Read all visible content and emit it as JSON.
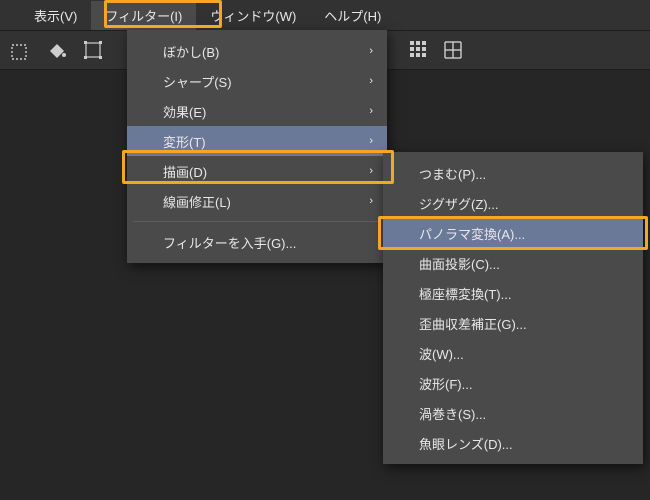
{
  "menubar": {
    "view": "表示(V)",
    "filter": "フィルター(I)",
    "window": "ウィンドウ(W)",
    "help": "ヘルプ(H)"
  },
  "filter_menu": {
    "blur": "ぼかし(B)",
    "sharpen": "シャープ(S)",
    "effect": "効果(E)",
    "transform": "変形(T)",
    "render": "描画(D)",
    "lineart": "線画修正(L)",
    "get": "フィルターを入手(G)..."
  },
  "transform_submenu": {
    "pinch": "つまむ(P)...",
    "zigzag": "ジグザグ(Z)...",
    "panorama": "パノラマ変換(A)...",
    "curved": "曲面投影(C)...",
    "polar": "極座標変換(T)...",
    "distort": "歪曲収差補正(G)...",
    "wave": "波(W)...",
    "waveform": "波形(F)...",
    "spiral": "渦巻き(S)...",
    "fisheye": "魚眼レンズ(D)..."
  },
  "glyphs": {
    "chevron": "›"
  }
}
